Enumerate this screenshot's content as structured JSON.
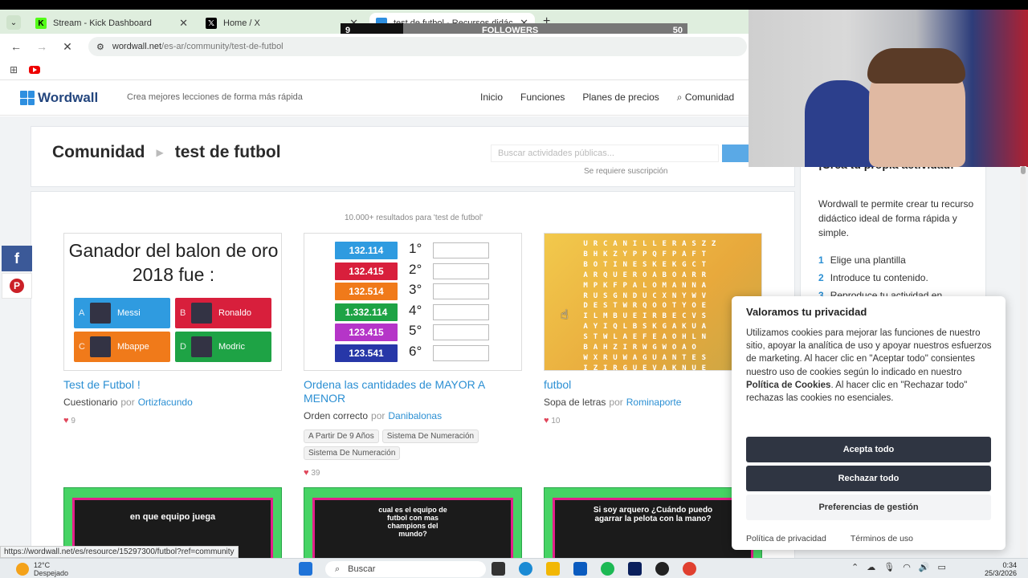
{
  "browser": {
    "tabs": [
      {
        "label": "Stream - Kick Dashboard",
        "icon": "kick-icon"
      },
      {
        "label": "Home / X",
        "icon": "x-icon"
      },
      {
        "label": "test de futbol - Recursos didác",
        "icon": "wordwall-tab-icon"
      }
    ],
    "url_host": "wordwall.net",
    "url_path": "/es-ar/community/test-de-futbol",
    "status_url": "https://wordwall.net/es/resource/15297300/futbol?ref=community"
  },
  "stream_overlay": {
    "count": "9",
    "label": "FOLLOWERS",
    "goal": "50",
    "progress": 0.18
  },
  "site": {
    "brand": "Wordwall",
    "tagline": "Crea mejores lecciones de forma más rápida",
    "nav": [
      "Inicio",
      "Funciones",
      "Planes de precios",
      "Comunidad"
    ],
    "breadcrumb_root": "Comunidad",
    "breadcrumb_current": "test de futbol",
    "search_placeholder": "Buscar actividades públicas...",
    "subscription_note": "Se requiere suscripción",
    "results_count": "10.000+ resultados para 'test de futbol'",
    "por": "por"
  },
  "cards": [
    {
      "title": "Test de Futbol !",
      "type": "Cuestionario",
      "author": "Ortizfacundo",
      "likes": "9",
      "question": "Ganador del balon de oro 2018 fue :",
      "answers": [
        {
          "letter": "A",
          "text": "Messi",
          "color": "#2f9be0"
        },
        {
          "letter": "B",
          "text": "Ronaldo",
          "color": "#d81f3c"
        },
        {
          "letter": "C",
          "text": "Mbappe",
          "color": "#f07a1a"
        },
        {
          "letter": "D",
          "text": "Modric",
          "color": "#1ea345"
        }
      ]
    },
    {
      "title": "Ordena las cantidades de MAYOR A MENOR",
      "type": "Orden correcto",
      "author": "Danibalonas",
      "likes": "39",
      "tags": [
        "A Partir De 9 Años",
        "Sistema De Numeración",
        "Sistema De Numeración"
      ],
      "rows": [
        {
          "value": "132.114",
          "color": "#2f9be0",
          "ord": "1°"
        },
        {
          "value": "132.415",
          "color": "#d81f3c",
          "ord": "2°"
        },
        {
          "value": "132.514",
          "color": "#f07a1a",
          "ord": "3°"
        },
        {
          "value": "1.332.114",
          "color": "#1ea345",
          "ord": "4°"
        },
        {
          "value": "123.415",
          "color": "#b535c8",
          "ord": "5°"
        },
        {
          "value": "123.541",
          "color": "#2737a8",
          "ord": "6°"
        }
      ]
    },
    {
      "title": "futbol",
      "type": "Sopa de letras",
      "author": "Rominaporte",
      "likes": "10",
      "grid": [
        "URCANILLERASZZ",
        "BHKZYPPQFPAFT",
        "BOTINESKEKGCT",
        "ARQUEROABOARR",
        "MPKFPALOMANNA",
        "RUSGNDUCXNYWV",
        "DESTWRQOOTYOE",
        "ILMBUEIRBECVS",
        "AYIQLBSKGAKUA",
        "STWLAEFEAOHLN",
        "BAHZIRWGWOAO",
        "WXRUWAGUANTES",
        "IZIRGUEVAKNUE"
      ]
    }
  ],
  "row2": [
    {
      "text": "en que equipo juega"
    },
    {
      "text": "cual es el equipo de futbol con mas champions del mundo?"
    },
    {
      "text": "Si soy arquero ¿Cuándo puedo agarrar la pelota con la mano?"
    }
  ],
  "sidebar": {
    "heading": "¡Crea tu propia actividad!",
    "text": "Wordwall te permite crear tu recurso didáctico ideal de forma rápida y simple.",
    "steps": [
      "Elige una plantilla",
      "Introduce tu contenido.",
      "Reproduce tu actividad en"
    ]
  },
  "cookie": {
    "title": "Valoramos tu privacidad",
    "body_1": "Utilizamos cookies para mejorar las funciones de nuestro sitio, apoyar la analítica de uso y apoyar nuestros esfuerzos de marketing. Al hacer clic en \"Aceptar todo\" consientes nuestro uso de cookies según lo indicado en nuestro ",
    "body_link": "Política de Cookies",
    "body_2": ". Al hacer clic en \"Rechazar todo\" rechazas las cookies no esenciales.",
    "accept": "Acepta todo",
    "reject": "Rechazar todo",
    "prefs": "Preferencias de gestión",
    "privacy_link": "Política de privacidad",
    "terms_link": "Términos de uso"
  },
  "taskbar": {
    "temp": "12°C",
    "weather": "Despejado",
    "search": "Buscar",
    "time": "0:34",
    "date": "25/3/2026"
  }
}
